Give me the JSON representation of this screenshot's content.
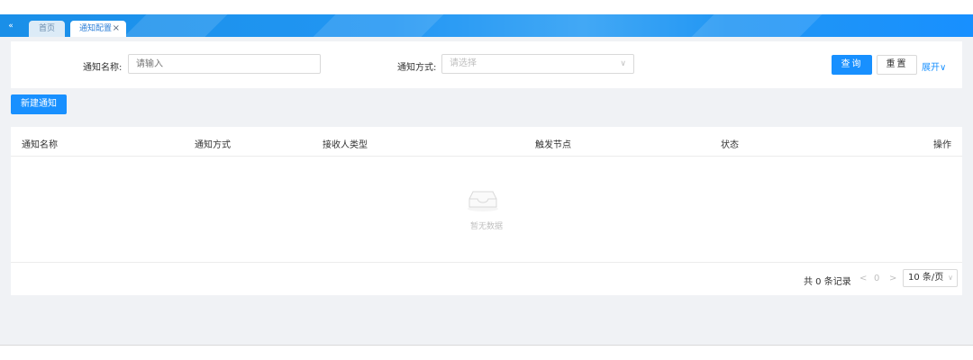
{
  "tabbar": {
    "collapse_icon": "«",
    "tabs": [
      {
        "label": "首页"
      },
      {
        "label": "通知配置",
        "close": "×"
      }
    ]
  },
  "search": {
    "name_label": "通知名称",
    "name_placeholder": "请输入",
    "method_label": "通知方式",
    "method_placeholder": "请选择",
    "colon": ":",
    "query_button": "查询",
    "reset_button": "重置",
    "expand_link": "展开",
    "expand_icon": "∨"
  },
  "toolbar": {
    "new_button": "新建通知"
  },
  "table": {
    "columns": [
      "通知名称",
      "通知方式",
      "接收人类型",
      "触发节点",
      "状态",
      "操作"
    ],
    "empty_text": "暂无数据"
  },
  "pagination": {
    "total_text": "共 0 条记录",
    "prev": "<",
    "current_page": "0",
    "next": ">",
    "page_size": "10 条/页",
    "size_arrow": "∨"
  }
}
